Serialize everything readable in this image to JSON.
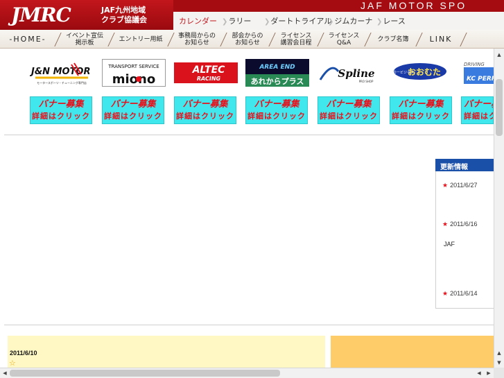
{
  "header": {
    "logo": "JMRC",
    "org_line1": "JAF九州地域",
    "org_line2": "クラブ協議会",
    "brand": "JAF MOTOR SPO"
  },
  "subnav": {
    "items": [
      "カレンダー",
      "ラリー",
      "ダートトライアル",
      "ジムカーナ",
      "レース"
    ]
  },
  "mainnav": {
    "items": [
      "-HOME-",
      "イベント宣伝\n掲示板",
      "エントリー用紙",
      "事務局からの\nお知らせ",
      "部会からの\nお知らせ",
      "ライセンス\n講習会日程",
      "ライセンス\nQ&A",
      "クラブ名簿",
      "LINK"
    ]
  },
  "sponsors": [
    {
      "name": "J&N MOTOR SPORTS",
      "sub": "モータースポーツ・チューニング専門店"
    },
    {
      "name": "TRANSPORT SERVICE",
      "sub": "miono"
    },
    {
      "name": "ALTEC",
      "sub": "RACING"
    },
    {
      "name": "AREA END",
      "sub": "あれからプラス"
    },
    {
      "name": "Spline",
      "sub": "PRO SHOP"
    },
    {
      "name": "おおむた",
      "sub": "カービジネス"
    },
    {
      "name": "DRIVING",
      "sub": "KC PERFORM"
    }
  ],
  "recruit_banner": {
    "line1": "バナー募集",
    "line2": "詳細はクリック"
  },
  "news": {
    "heading": "更新情報",
    "entries": [
      {
        "date": "2011/6/27",
        "text": ""
      },
      {
        "date": "2011/6/16",
        "text": "JAF"
      },
      {
        "date": "2011/6/14",
        "text": ""
      }
    ]
  },
  "panel": {
    "date": "2011/6/10",
    "star": "☆"
  },
  "colors": {
    "header_red": "#a40c11",
    "accent_red": "#e8111b",
    "banner_cyan": "#40e8ee",
    "news_blue": "#1b50a8",
    "panel_yellow": "#fff8c4",
    "panel_orange": "#ffcc6a"
  }
}
